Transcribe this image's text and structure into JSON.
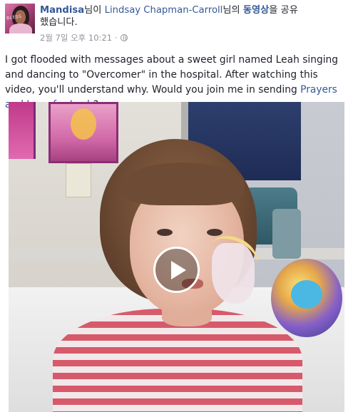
{
  "post": {
    "page_name": "Mandisa",
    "shared_by_particle": "님이",
    "original_author": "Lindsay Chapman-Carroll",
    "author_particle": "님의",
    "video_link_text": "동영상",
    "shared_suffix_line1": "을 공유",
    "shared_suffix_line2": "했습니다.",
    "timestamp": "2월 7일 오후 10:21",
    "separator": "·",
    "caption_text": "I got flooded with messages about a sweet girl named Leah singing and dancing to \"Overcomer\" in the hospital. After watching this video, you'll understand why. Would you join me in sending ",
    "caption_link": "Prayers and Love for Leah",
    "caption_end": "?",
    "avatar_text": "BLESS"
  },
  "icons": {
    "audience": "globe-icon",
    "play": "play-icon"
  },
  "colors": {
    "link": "#365899",
    "text": "#1d2129",
    "meta": "#90949c"
  }
}
